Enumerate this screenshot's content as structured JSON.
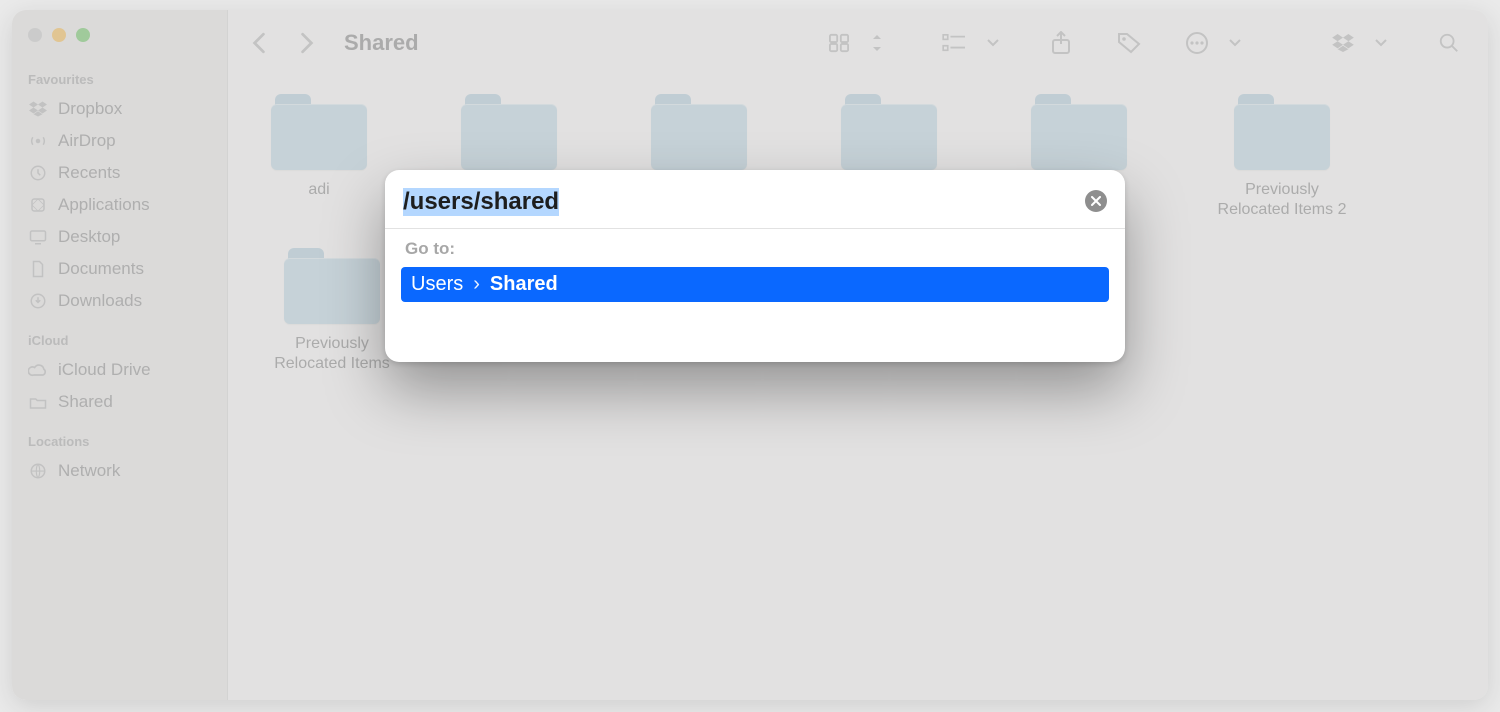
{
  "window_title": "Shared",
  "sidebar": {
    "sections": [
      {
        "title": "Favourites",
        "items": [
          {
            "icon": "dropbox-icon",
            "label": "Dropbox"
          },
          {
            "icon": "airdrop-icon",
            "label": "AirDrop"
          },
          {
            "icon": "recents-icon",
            "label": "Recents"
          },
          {
            "icon": "applications-icon",
            "label": "Applications"
          },
          {
            "icon": "desktop-icon",
            "label": "Desktop"
          },
          {
            "icon": "documents-icon",
            "label": "Documents"
          },
          {
            "icon": "downloads-icon",
            "label": "Downloads"
          }
        ]
      },
      {
        "title": "iCloud",
        "items": [
          {
            "icon": "icloud-icon",
            "label": "iCloud Drive"
          },
          {
            "icon": "shared-icon",
            "label": "Shared"
          }
        ]
      },
      {
        "title": "Locations",
        "items": [
          {
            "icon": "network-icon",
            "label": "Network"
          }
        ]
      }
    ]
  },
  "toolbar": {
    "back_aria": "Back",
    "forward_aria": "Forward",
    "view_aria": "Icon View",
    "group_aria": "Group",
    "share_aria": "Share",
    "tags_aria": "Tags",
    "more_aria": "More",
    "dropbox_aria": "Dropbox",
    "search_aria": "Search"
  },
  "folders": [
    {
      "label": "adi"
    },
    {
      "label": ""
    },
    {
      "label": ""
    },
    {
      "label": ""
    },
    {
      "label": ""
    },
    {
      "label": "Previously Relocated Items 2"
    },
    {
      "label": "Previously Relocated Items"
    }
  ],
  "goto": {
    "input_value": "/users/shared",
    "label": "Go to:",
    "result_seg1": "Users",
    "result_sep": "›",
    "result_seg2": "Shared"
  }
}
